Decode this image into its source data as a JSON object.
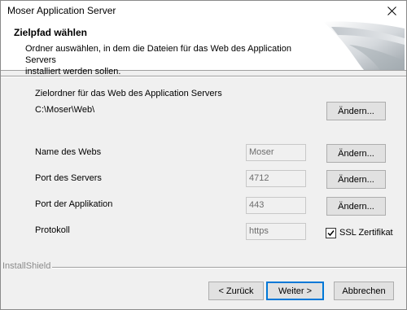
{
  "window": {
    "title": "Moser Application Server"
  },
  "header": {
    "title": "Zielpfad wählen",
    "description_line1": "Ordner auswählen, in dem die Dateien für das Web des Application Servers",
    "description_line2": "installiert werden sollen."
  },
  "target_folder": {
    "label": "Zielordner für das Web des Application Servers",
    "path": "C:\\Moser\\Web\\",
    "change_label": "Ändern..."
  },
  "web_name": {
    "label": "Name des Webs",
    "value": "Moser",
    "change_label": "Ändern..."
  },
  "server_port": {
    "label": "Port des Servers",
    "value": "4712",
    "change_label": "Ändern..."
  },
  "app_port": {
    "label": "Port der Applikation",
    "value": "443",
    "change_label": "Ändern..."
  },
  "protocol": {
    "label": "Protokoll",
    "value": "https"
  },
  "ssl": {
    "label": "SSL Zertifikat",
    "checked": true
  },
  "brand": "InstallShield",
  "footer": {
    "back_label": "< Zurück",
    "next_label": "Weiter >",
    "cancel_label": "Abbrechen"
  },
  "colors": {
    "default_button_border": "#0078d7",
    "button_face": "#e1e1e1",
    "dialog_bg": "#f0f0f0"
  }
}
